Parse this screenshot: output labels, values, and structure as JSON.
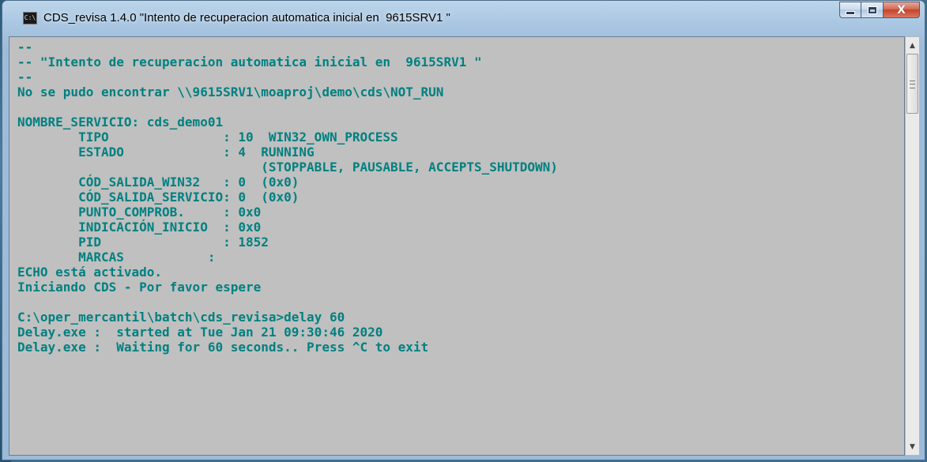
{
  "window": {
    "title": "CDS_revisa 1.4.0 \"Intento de recuperacion automatica inicial en  9615SRV1 \"",
    "icon": "console-icon",
    "icon_text": "C:\\",
    "buttons": {
      "minimize": "minimize-icon",
      "maximize": "maximize-icon",
      "close": "close-icon",
      "close_glyph": "X"
    }
  },
  "console": {
    "text_color": "#008080",
    "background": "#c0c0c0",
    "lines": [
      "--",
      "-- \"Intento de recuperacion automatica inicial en  9615SRV1 \"",
      "--",
      "No se pudo encontrar \\\\9615SRV1\\moaproj\\demo\\cds\\NOT_RUN",
      "",
      "NOMBRE_SERVICIO: cds_demo01",
      "        TIPO               : 10  WIN32_OWN_PROCESS",
      "        ESTADO             : 4  RUNNING",
      "                                (STOPPABLE, PAUSABLE, ACCEPTS_SHUTDOWN)",
      "        CÓD_SALIDA_WIN32   : 0  (0x0)",
      "        CÓD_SALIDA_SERVICIO: 0  (0x0)",
      "        PUNTO_COMPROB.     : 0x0",
      "        INDICACIÓN_INICIO  : 0x0",
      "        PID                : 1852",
      "        MARCAS           :",
      "ECHO está activado.",
      "Iniciando CDS - Por favor espere",
      "",
      "C:\\oper_mercantil\\batch\\cds_revisa>delay 60",
      "Delay.exe :  started at Tue Jan 21 09:30:46 2020",
      "Delay.exe :  Waiting for 60 seconds.. Press ^C to exit"
    ]
  },
  "scrollbar": {
    "up": "scroll-up-arrow-icon",
    "down": "scroll-down-arrow-icon",
    "up_glyph": "▲",
    "down_glyph": "▼"
  }
}
